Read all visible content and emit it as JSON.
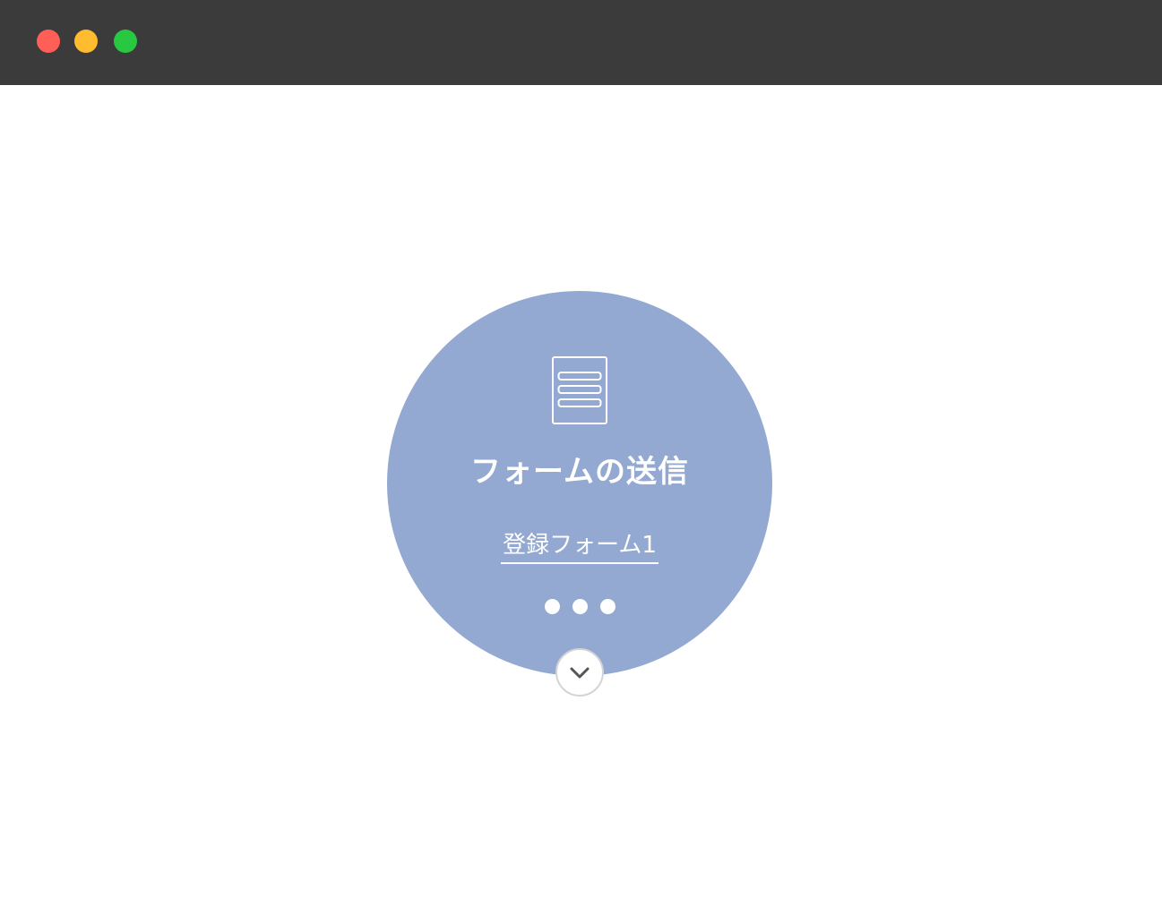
{
  "window": {
    "controls": {
      "close_color": "#ff5f57",
      "minimize_color": "#febc2e",
      "maximize_color": "#28c840"
    },
    "titlebar_color": "#3b3b3b"
  },
  "node": {
    "color": "#93a9d1",
    "icon": "form-document-icon",
    "title": "フォームの送信",
    "link_label": "登録フォーム1",
    "more_icon": "ellipsis-dots-icon",
    "expand_icon": "chevron-down-icon"
  }
}
